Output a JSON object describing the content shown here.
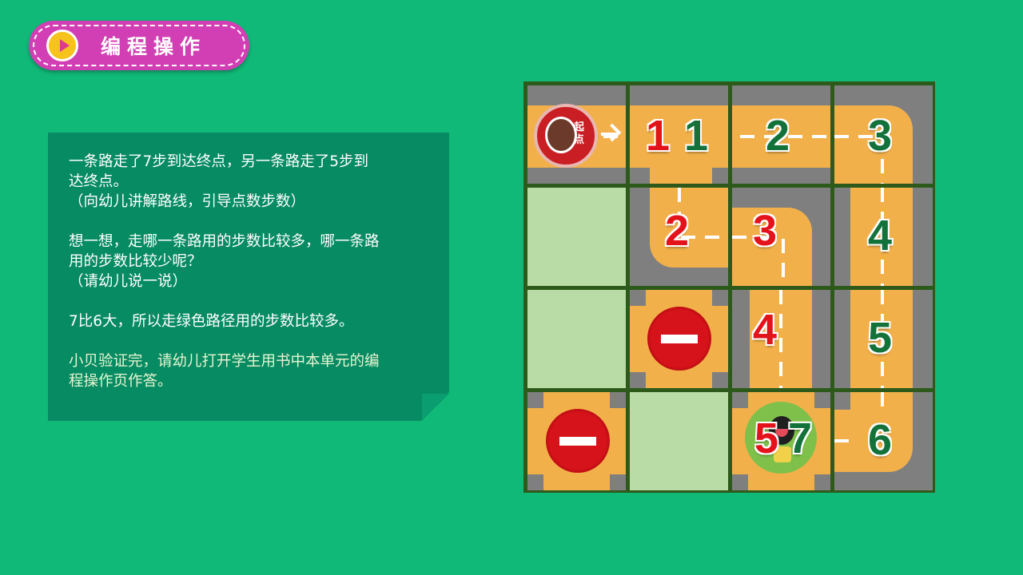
{
  "header": {
    "title": "编程操作",
    "icon": "play-icon",
    "color": "#d23fb4"
  },
  "card": {
    "lines": [
      "一条路走了7步到达终点，另一条路走了5步到",
      "达终点。",
      "（向幼儿讲解路线，引导点数步数）",
      "想一想，走哪一条路用的步数比较多，哪一条路",
      "用的步数比较少呢？",
      "（请幼儿说一说）",
      "7比6大，所以走绿色路径用的步数比较多。",
      "小贝验证完，请幼儿打开学生用书中本单元的编",
      "程操作页作答。"
    ]
  },
  "board": {
    "start_label": "起点",
    "red_path_numbers": [
      "1",
      "2",
      "3",
      "4",
      "5"
    ],
    "green_path_numbers": [
      "1",
      "2",
      "3",
      "4",
      "5",
      "6",
      "7"
    ],
    "colors": {
      "red": "#e3121b",
      "green": "#13713a",
      "road": "#f2b04a",
      "grass": "#b9dca6"
    }
  }
}
